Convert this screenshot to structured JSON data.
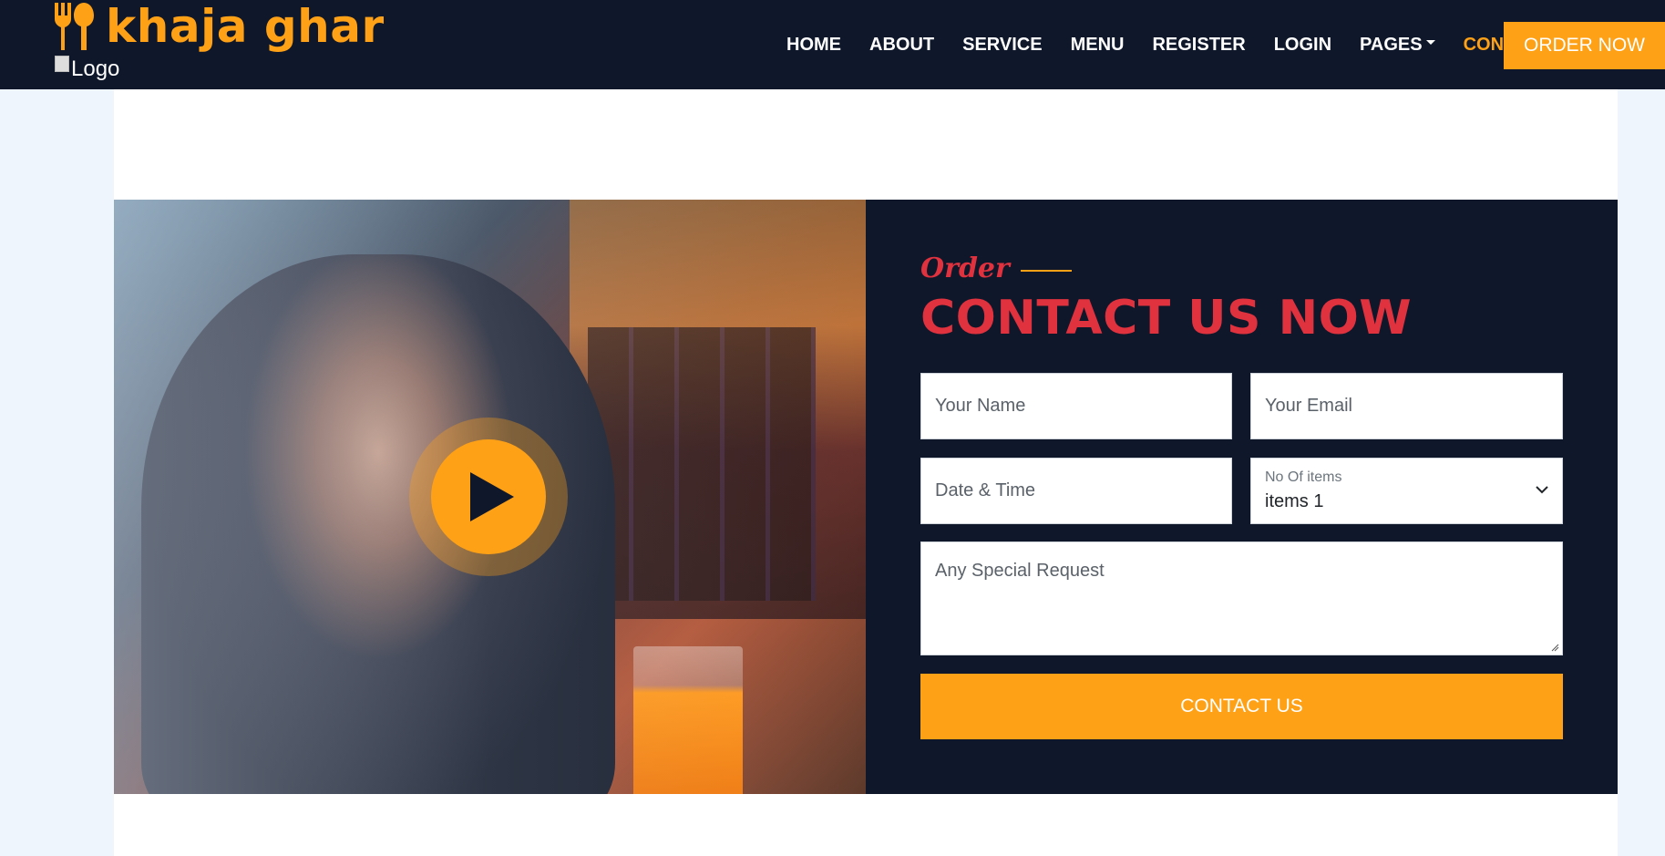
{
  "brand": {
    "name": "khaja ghar",
    "logo_alt": "Logo",
    "icon": "utensils-icon"
  },
  "nav": {
    "items": [
      {
        "label": "HOME"
      },
      {
        "label": "ABOUT"
      },
      {
        "label": "SERVICE"
      },
      {
        "label": "MENU"
      },
      {
        "label": "REGISTER"
      },
      {
        "label": "LOGIN"
      },
      {
        "label": "PAGES"
      },
      {
        "label": "CONTACT"
      }
    ],
    "active": "CONTACT",
    "cta": "ORDER NOW"
  },
  "video": {
    "icon": "play-icon"
  },
  "form": {
    "subtitle": "Order",
    "title": "CONTACT US NOW",
    "name_placeholder": "Your Name",
    "email_placeholder": "Your Email",
    "datetime_placeholder": "Date & Time",
    "items_label": "No Of items",
    "items_value": "items 1",
    "request_placeholder": "Any Special Request",
    "submit_label": "CONTACT US"
  },
  "colors": {
    "primary": "#fea116",
    "dark": "#0f172b",
    "accent": "#e0323e"
  }
}
